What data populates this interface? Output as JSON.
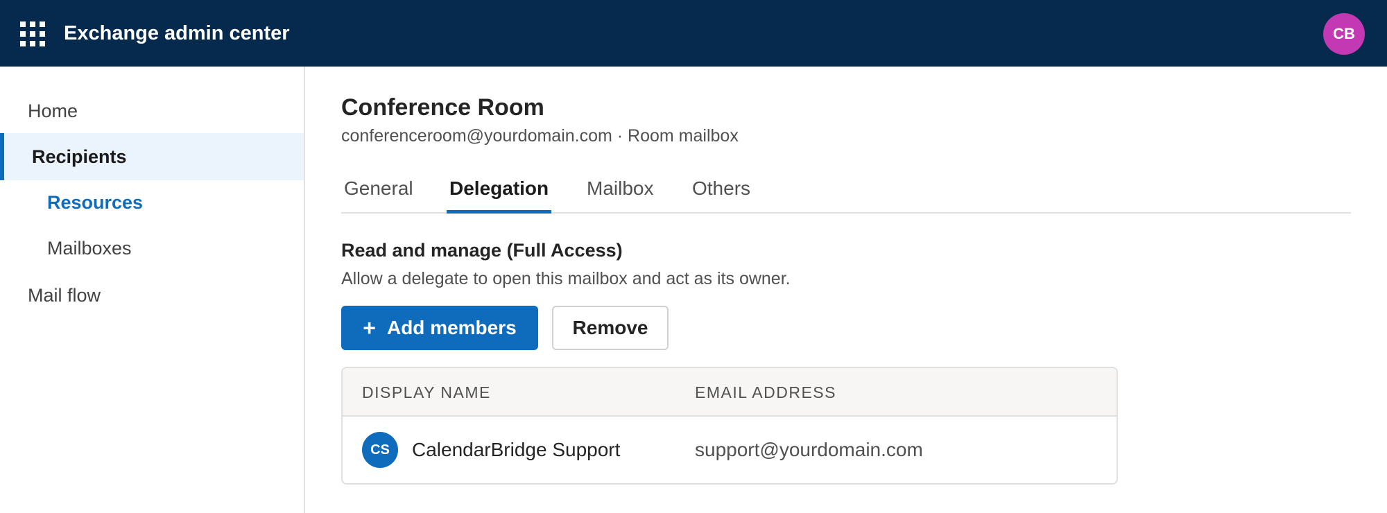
{
  "header": {
    "app_title": "Exchange admin center",
    "apps_icon": "waffle-grid-icon",
    "user_initials": "CB",
    "user_avatar_color": "#c239b3",
    "background_color": "#062a4d"
  },
  "sidebar": {
    "items": [
      {
        "label": "Home",
        "level": "top",
        "state": "normal"
      },
      {
        "label": "Recipients",
        "level": "top",
        "state": "selected"
      },
      {
        "label": "Resources",
        "level": "sub",
        "state": "active"
      },
      {
        "label": "Mailboxes",
        "level": "sub",
        "state": "normal"
      },
      {
        "label": "Mail flow",
        "level": "top",
        "state": "normal"
      }
    ]
  },
  "main": {
    "title": "Conference Room",
    "subtitle": "conferenceroom@yourdomain.com · Room mailbox",
    "tabs": [
      {
        "label": "General",
        "active": false
      },
      {
        "label": "Delegation",
        "active": true
      },
      {
        "label": "Mailbox",
        "active": false
      },
      {
        "label": "Others",
        "active": false
      }
    ],
    "section": {
      "title": "Read and manage (Full Access)",
      "description": "Allow a delegate to open this mailbox and act as its owner.",
      "add_button": {
        "icon": "plus-icon",
        "label": "Add members"
      },
      "remove_button": {
        "label": "Remove"
      }
    },
    "table": {
      "columns": [
        "DISPLAY NAME",
        "EMAIL ADDRESS"
      ],
      "rows": [
        {
          "initials": "CS",
          "display_name": "CalendarBridge Support",
          "email": "support@yourdomain.com"
        }
      ]
    }
  },
  "colors": {
    "accent": "#0f6cbd",
    "selected_nav_bg": "#ebf3fc"
  }
}
